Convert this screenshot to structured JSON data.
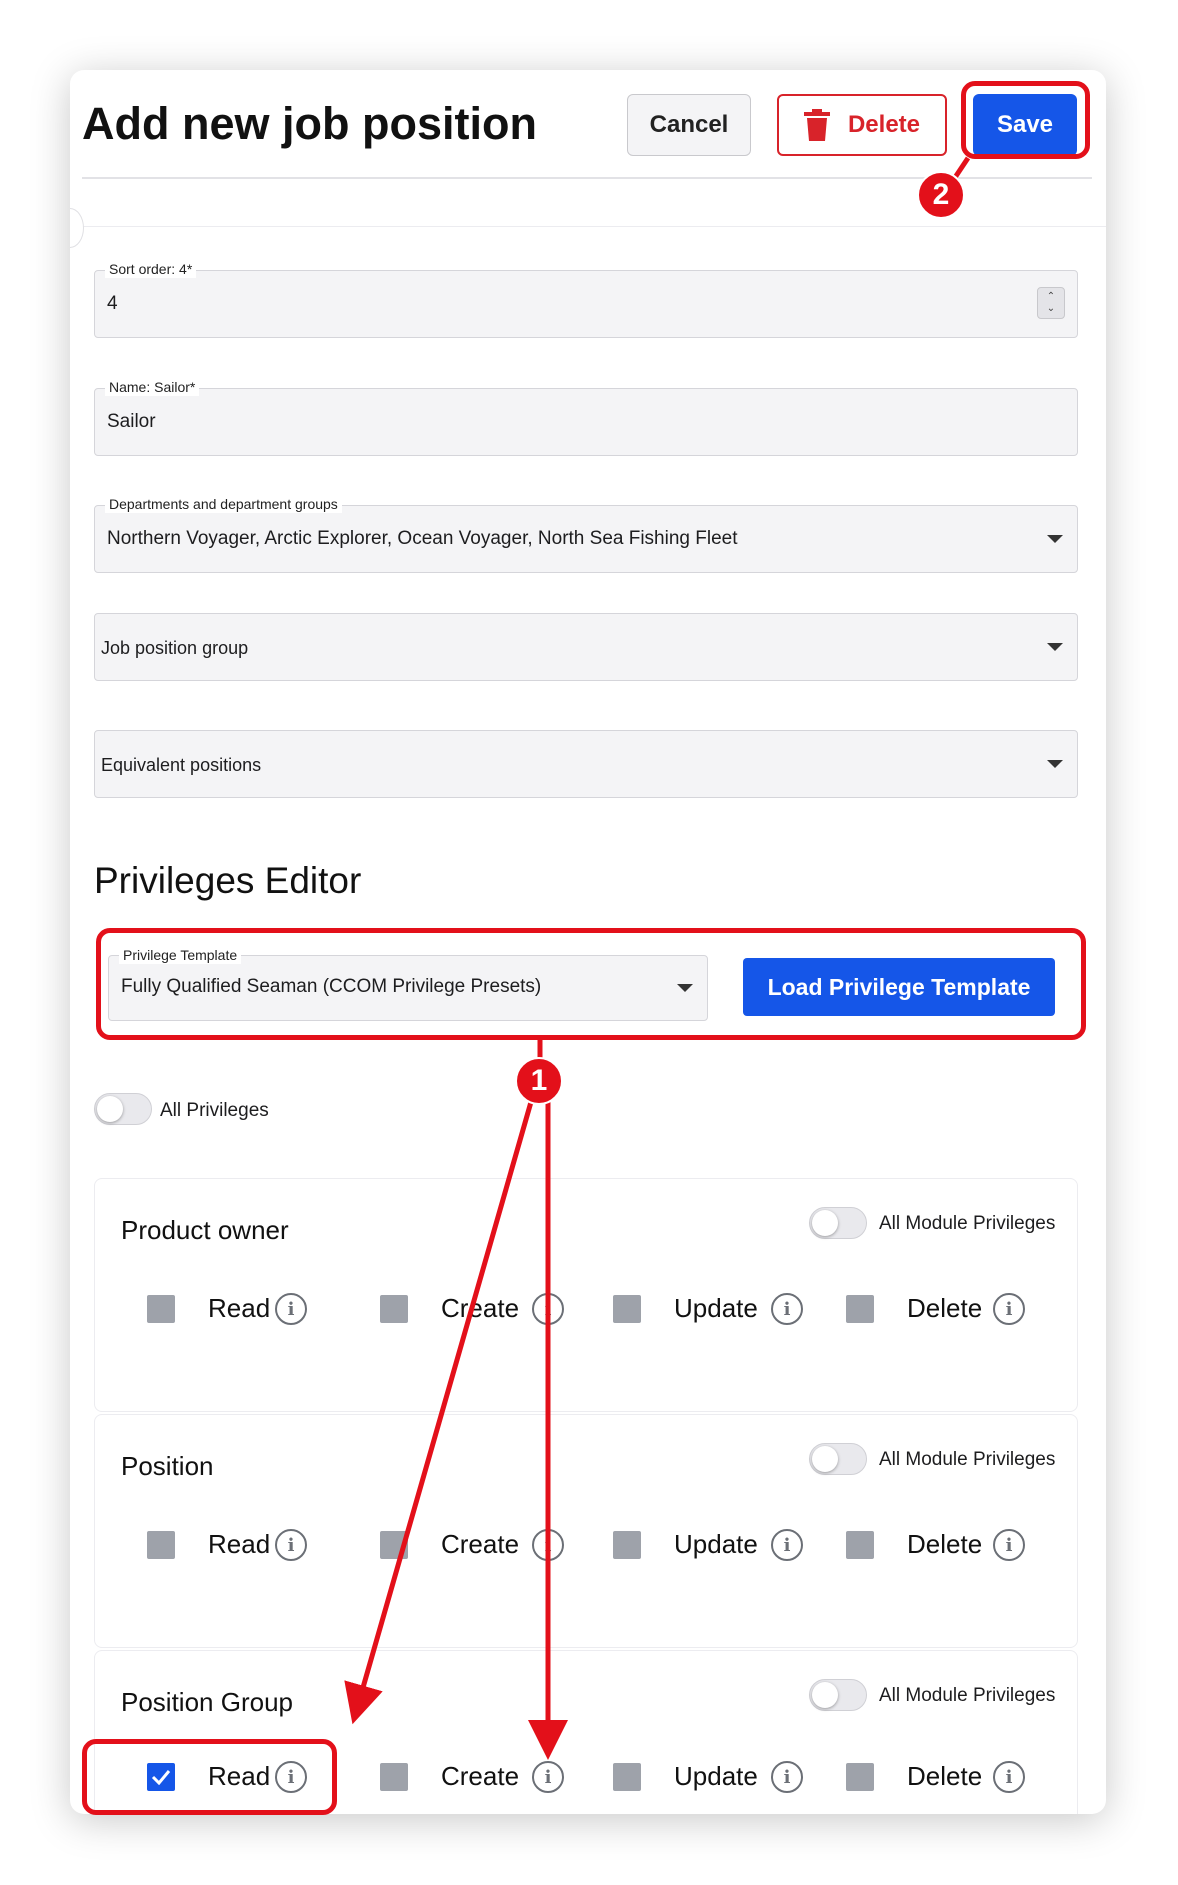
{
  "header": {
    "title": "Add new job position",
    "cancel_label": "Cancel",
    "delete_label": "Delete",
    "save_label": "Save"
  },
  "fields": {
    "sort_order": {
      "legend": "Sort order: 4*",
      "value": "4"
    },
    "name": {
      "legend": "Name: Sailor*",
      "value": "Sailor"
    },
    "departments": {
      "legend": "Departments and department groups",
      "value": "Northern Voyager, Arctic Explorer, Ocean Voyager, North Sea Fishing Fleet"
    },
    "job_position_group": {
      "placeholder": "Job position group"
    },
    "equivalent_positions": {
      "placeholder": "Equivalent positions"
    }
  },
  "privileges": {
    "title": "Privileges Editor",
    "template_legend": "Privilege Template",
    "template_value": "Fully Qualified Seaman (CCOM Privilege Presets)",
    "load_label": "Load Privilege Template",
    "all_label": "All Privileges",
    "module_toggle_label": "All Module Privileges",
    "modules": [
      {
        "name": "Product owner",
        "read": "Read",
        "create": "Create",
        "update": "Update",
        "delete": "Delete"
      },
      {
        "name": "Position",
        "read": "Read",
        "create": "Create",
        "update": "Update",
        "delete": "Delete"
      },
      {
        "name": "Position Group",
        "read": "Read",
        "create": "Create",
        "update": "Update",
        "delete": "Delete"
      }
    ]
  },
  "annotations": {
    "badge_1": "1",
    "badge_2": "2"
  },
  "colors": {
    "primary": "#1556e8",
    "danger": "#d8232a",
    "annotation": "#e3101a"
  }
}
